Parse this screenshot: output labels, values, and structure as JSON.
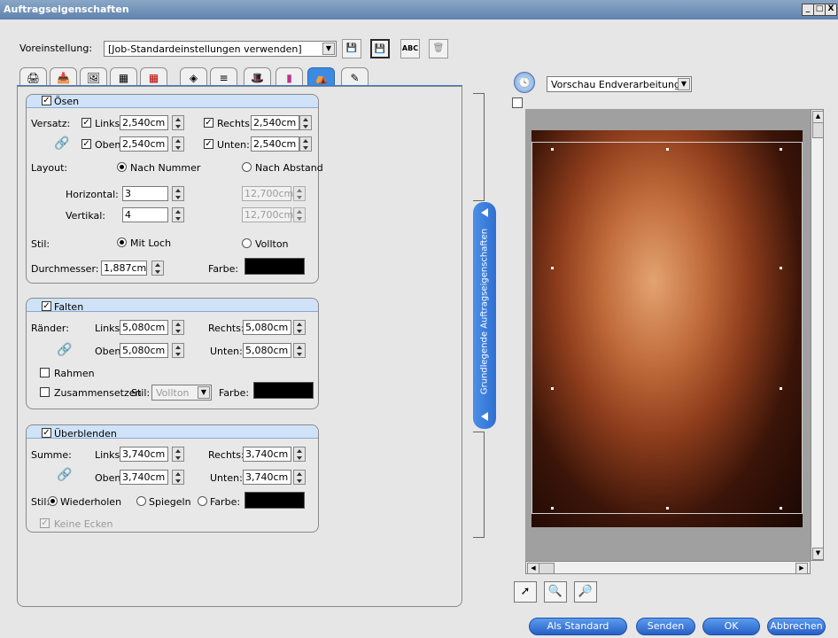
{
  "window": {
    "title": "Auftragseigenschaften",
    "minimize": "_",
    "maximize": "□",
    "close": "X"
  },
  "preset": {
    "label": "Voreinstellung:",
    "value": "[Job-Standardeinstellungen verwenden]",
    "icons": [
      "save-icon",
      "save-as-icon",
      "rename-icon",
      "delete-icon"
    ],
    "abc": "ABC"
  },
  "tabs": [
    "printer-icon",
    "input-icon",
    "image-icon",
    "layout-icon",
    "grid-icon",
    "color-icon",
    "layers-icon",
    "hat-icon",
    "bars-icon",
    "finishing-icon",
    "profile-icon"
  ],
  "oesen": {
    "title": "Ösen",
    "versatz": "Versatz:",
    "links_label": "Links:",
    "links": "2,540cm",
    "rechts_label": "Rechts:",
    "rechts": "2,540cm",
    "oben_label": "Oben:",
    "oben": "2,540cm",
    "unten_label": "Unten:",
    "unten": "2,540cm",
    "layout_label": "Layout:",
    "nach_nummer": "Nach Nummer",
    "nach_abstand": "Nach Abstand",
    "horizontal_label": "Horizontal:",
    "horizontal": "3",
    "horizontal_dist": "12,700cm",
    "vertikal_label": "Vertikal:",
    "vertikal": "4",
    "vertikal_dist": "12,700cm",
    "stil_label": "Stil:",
    "mit_loch": "Mit Loch",
    "vollton": "Vollton",
    "durchmesser_label": "Durchmesser:",
    "durchmesser": "1,887cm",
    "farbe_label": "Farbe:",
    "farbe": "#000000"
  },
  "falten": {
    "title": "Falten",
    "raender": "Ränder:",
    "links_label": "Links:",
    "links": "5,080cm",
    "rechts_label": "Rechts:",
    "rechts": "5,080cm",
    "oben_label": "Oben:",
    "oben": "5,080cm",
    "unten_label": "Unten:",
    "unten": "5,080cm",
    "rahmen": "Rahmen",
    "zusammensetzen": "Zusammensetzen",
    "stil_label": "Stil:",
    "stil": "Vollton",
    "farbe_label": "Farbe:"
  },
  "ueberblenden": {
    "title": "Überblenden",
    "summe": "Summe:",
    "links_label": "Links:",
    "links": "3,740cm",
    "rechts_label": "Rechts:",
    "rechts": "3,740cm",
    "oben_label": "Oben:",
    "oben": "3,740cm",
    "unten_label": "Unten:",
    "unten": "3,740cm",
    "stil_label": "Stil:",
    "wiederholen": "Wiederholen",
    "spiegeln": "Spiegeln",
    "farbe": "Farbe:",
    "keine_ecken": "Keine Ecken"
  },
  "collapse_label": "Grundlegende Auftragseigenschaften",
  "preview": {
    "mode": "Vorschau Endverarbeitung"
  },
  "buttons": {
    "standard": "Als Standard",
    "senden": "Senden",
    "ok": "OK",
    "abbrechen": "Abbrechen"
  },
  "colors": {
    "accent": "#3a78d4",
    "panel": "#e6e6e6"
  }
}
